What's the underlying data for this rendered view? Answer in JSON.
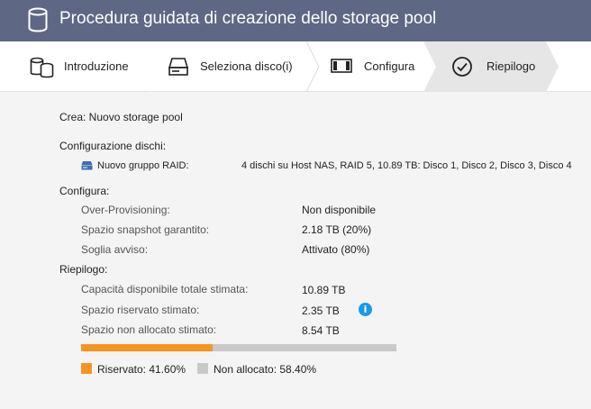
{
  "window": {
    "title": "Procedura guidata di creazione dello storage pool",
    "icon": "database-icon"
  },
  "steps": [
    {
      "label": "Introduzione",
      "icon": "disks-icon",
      "active": false
    },
    {
      "label": "Seleziona disco(i)",
      "icon": "disk-drive-icon",
      "active": false
    },
    {
      "label": "Configura",
      "icon": "storage-block-icon",
      "active": false
    },
    {
      "label": "Riepilogo",
      "icon": "check-circle-icon",
      "active": true
    }
  ],
  "summary": {
    "create_line": "Crea: Nuovo storage pool",
    "disk_config": {
      "heading": "Configurazione dischi:",
      "group_label": "Nuovo gruppo RAID:",
      "group_value": "4 dischi su Host NAS, RAID 5, 10.89 TB: Disco 1, Disco 2, Disco 3, Disco 4"
    },
    "configure": {
      "heading": "Configura:",
      "rows": [
        {
          "key": "Over-Provisioning:",
          "value": "Non disponibile"
        },
        {
          "key": "Spazio snapshot garantito:",
          "value": "2.18 TB (20%)"
        },
        {
          "key": "Soglia avviso:",
          "value": "Attivato (80%)"
        }
      ]
    },
    "recap": {
      "heading": "Riepilogo:",
      "rows": [
        {
          "key": "Capacità disponibile totale stimata:",
          "value": "10.89 TB"
        },
        {
          "key": "Spazio riservato stimato:",
          "value": "2.35 TB"
        },
        {
          "key": "Spazio non allocato stimato:",
          "value": "8.54 TB"
        }
      ],
      "info_icon": "i"
    },
    "usage": {
      "reserved_fraction": 0.416,
      "reserved_color": "#f7941d",
      "unallocated_color": "#c9c9c9",
      "legend_reserved": "Riservato: 41.60%",
      "legend_unallocated": "Non allocato: 58.40%"
    }
  },
  "colors": {
    "titlebar": "#5e6783",
    "active_step": "#e6e6e6",
    "info": "#1a9ae8",
    "raid_icon": "#3a6fb5"
  }
}
